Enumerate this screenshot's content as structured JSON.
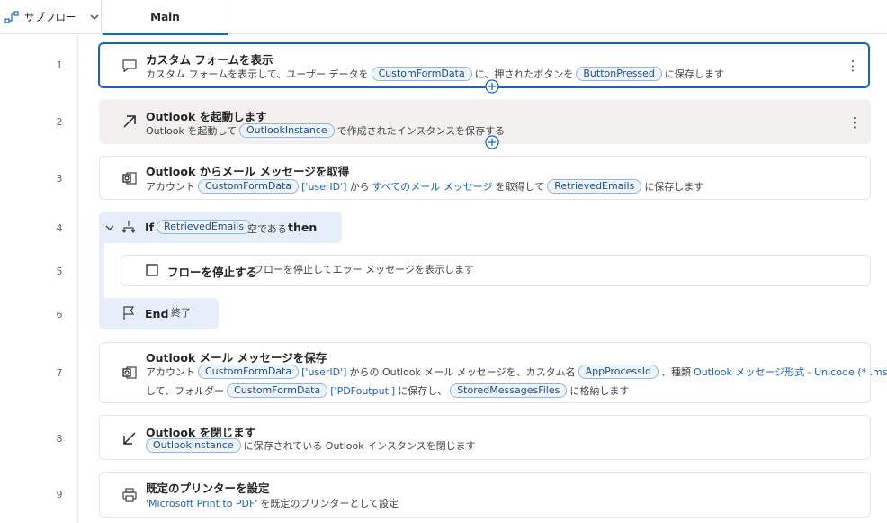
{
  "header": {
    "subflow_label": "サブフロー",
    "tab_main": "Main"
  },
  "line_numbers": [
    "1",
    "2",
    "3",
    "4",
    "5",
    "6",
    "7",
    "8",
    "9"
  ],
  "steps": {
    "s1": {
      "title": "カスタム フォームを表示",
      "d1": "カスタム フォームを表示して、ユーザー データを",
      "t1": "CustomFormData",
      "d2": "に、押されたボタンを",
      "t2": "ButtonPressed",
      "d3": "に保存します"
    },
    "s2": {
      "title": "Outlook を起動します",
      "d1": "Outlook を起動して",
      "t1": "OutlookInstance",
      "d2": "で作成されたインスタンスを保存する"
    },
    "s3": {
      "title": "Outlook からメール メッセージを取得",
      "d1": "アカウント",
      "t1": "CustomFormData",
      "l1": "['userID']",
      "d2": "から",
      "l2": "すべてのメール メッセージ",
      "d3": "を取得して",
      "t2": "RetrievedEmails",
      "d4": "に保存します"
    },
    "s4": {
      "kw_if": "If",
      "t1": "RetrievedEmails",
      "d1": "空である",
      "kw_then": "then"
    },
    "s5": {
      "title": "フローを停止する",
      "d1": "フローを停止してエラー メッセージを表示します"
    },
    "s6": {
      "kw_end": "End",
      "d1": "終了"
    },
    "s7": {
      "title": "Outlook メール メッセージを保存",
      "d1": "アカウント",
      "t1": "CustomFormData",
      "l1": "['userID']",
      "d2": "からの Outlook メール メッセージを、カスタム名",
      "t2": "AppProcessId",
      "d3": "、種類",
      "l2": "Outlook メッセージ形式 - Unicode (* .msg)",
      "d4": "と",
      "d5": "して、フォルダー",
      "t3": "CustomFormData",
      "l3": "['PDFoutput']",
      "d6": "に保存し、",
      "t4": "StoredMessagesFiles",
      "d7": "に格納します"
    },
    "s8": {
      "title": "Outlook を閉じます",
      "t1": "OutlookInstance",
      "d1": "に保存されている Outlook インスタンスを閉じます"
    },
    "s9": {
      "title": "既定のプリンターを設定",
      "l1": "'Microsoft Print to PDF'",
      "d1": "を既定のプリンターとして設定"
    }
  },
  "icons": {
    "subflow": "subflow-icon",
    "chevron": "chevron-down-icon",
    "s1": "message-box-icon",
    "s2": "launch-arrow-icon",
    "s3": "outlook-icon",
    "s4": "branch-icon",
    "s5": "stop-square-icon",
    "s6": "flag-icon",
    "s7": "outlook-icon",
    "s8": "close-arrow-icon",
    "s9": "printer-icon",
    "kebab": "more-vertical-icon",
    "ai": "copilot-sparkle-icon"
  },
  "colors": {
    "accent": "#1a64c8",
    "token_border": "#8fb4e6",
    "token_bg": "#eef4fc",
    "link": "#1d61c4",
    "if_block": "#e6eefa"
  }
}
